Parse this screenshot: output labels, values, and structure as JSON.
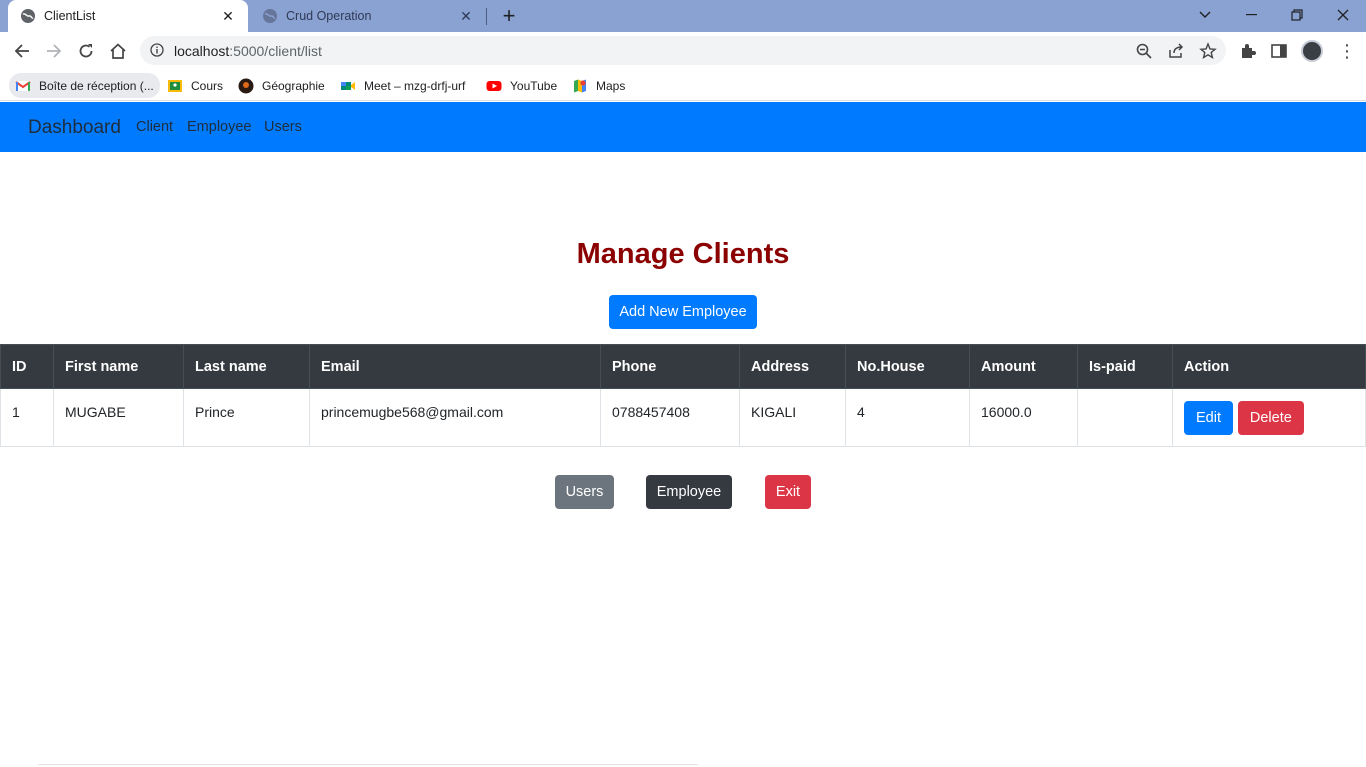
{
  "browser": {
    "tabs": [
      {
        "title": "ClientList",
        "active": true
      },
      {
        "title": "Crud Operation",
        "active": false
      }
    ],
    "url_host": "localhost",
    "url_rest": ":5000/client/list",
    "bookmarks": [
      {
        "label": "Boîte de réception (...",
        "icon": "gmail-icon"
      },
      {
        "label": "Cours",
        "icon": "classroom-icon"
      },
      {
        "label": "Géographie",
        "icon": "geography-icon"
      },
      {
        "label": "Meet – mzg-drfj-urf",
        "icon": "meet-icon"
      },
      {
        "label": "YouTube",
        "icon": "youtube-icon"
      },
      {
        "label": "Maps",
        "icon": "maps-icon"
      }
    ]
  },
  "navbar": {
    "brand": "Dashboard",
    "links": [
      "Client",
      "Employee",
      "Users"
    ]
  },
  "page": {
    "title": "Manage Clients",
    "add_button": "Add New Employee"
  },
  "table": {
    "headers": [
      "ID",
      "First name",
      "Last name",
      "Email",
      "Phone",
      "Address",
      "No.House",
      "Amount",
      "Is-paid",
      "Action"
    ],
    "rows": [
      {
        "id": "1",
        "first_name": "MUGABE",
        "last_name": "Prince",
        "email": "princemugbe568@gmail.com",
        "phone": "0788457408",
        "address": "KIGALI",
        "house": "4",
        "amount": "16000.0",
        "is_paid": "",
        "edit_label": "Edit",
        "delete_label": "Delete"
      }
    ]
  },
  "footer_buttons": {
    "users": "Users",
    "employee": "Employee",
    "exit": "Exit"
  },
  "colors": {
    "navbar": "#007bff",
    "heading": "#8b0000",
    "primary": "#007bff",
    "danger": "#dc3545",
    "secondary": "#6c757d",
    "dark": "#343a40",
    "tabbar": "#8aa2d2"
  }
}
